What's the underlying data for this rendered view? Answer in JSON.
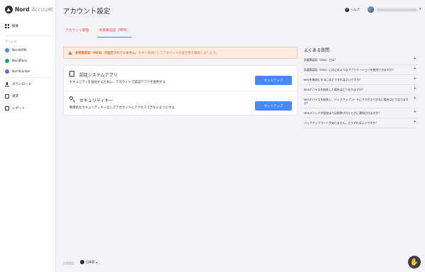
{
  "brand": {
    "name": "Nord",
    "sub": "Account"
  },
  "sidebar": {
    "collapse_icon": "collapse-icon",
    "section_label": "サービス",
    "items": [
      {
        "label": "概要",
        "icon": "grid-icon"
      },
      {
        "label": "NordVPN",
        "icon": "nordvpn-icon"
      },
      {
        "label": "NordPass",
        "icon": "nordpass-icon"
      },
      {
        "label": "NordLocker",
        "icon": "nordlocker-icon"
      },
      {
        "label": "ダウンロード",
        "icon": "download-icon"
      },
      {
        "label": "請求",
        "icon": "billing-icon"
      },
      {
        "label": "レポート",
        "icon": "report-icon"
      }
    ]
  },
  "header": {
    "title": "アカウント設定",
    "help_label": "ヘルプ"
  },
  "tabs": [
    {
      "label": "アカウント管理",
      "active": false
    },
    {
      "label": "多要素認証（MFA）",
      "active": true
    }
  ],
  "alert": {
    "bold": "多要素認証（MFA）が設定されていません。",
    "text": "今すぐ有効にしてアカウントの安全性を確保しましょう。",
    "color": "#e0752c"
  },
  "methods": [
    {
      "title": "認証システムアプリ",
      "description": "セキュリティを強化するために、アカウントで認証アプリを使用する",
      "button": "セットアップ",
      "icon": "phone-icon"
    },
    {
      "title": "セキュリティキー",
      "description": "物理的なセキュリティキーなしでアカウントにアクセスできないようにする",
      "button": "セットアップ",
      "icon": "key-icon"
    }
  ],
  "faq": {
    "title": "よくある質問",
    "items": [
      "多要素認証（MFA）とは？",
      "多要素認証（MFA）にはどのようなアプリケーションを使用できますか？",
      "MFAを無効にするにはどうすればよいですか？",
      "MFAデバイスを紛失した場合はどうなりますか？",
      "MFAデバイスを紛失し、バックアップコードにアクセスできない場合はどうなりますか？",
      "MFAメソッドが追加または削除されたときに通知されますか？",
      "バックアップコードがありません。どうすればよいですか？"
    ]
  },
  "footer": {
    "label": "言語設定",
    "language": "日本語"
  },
  "colors": {
    "accent": "#4687ff",
    "tab": "#e5474b"
  }
}
